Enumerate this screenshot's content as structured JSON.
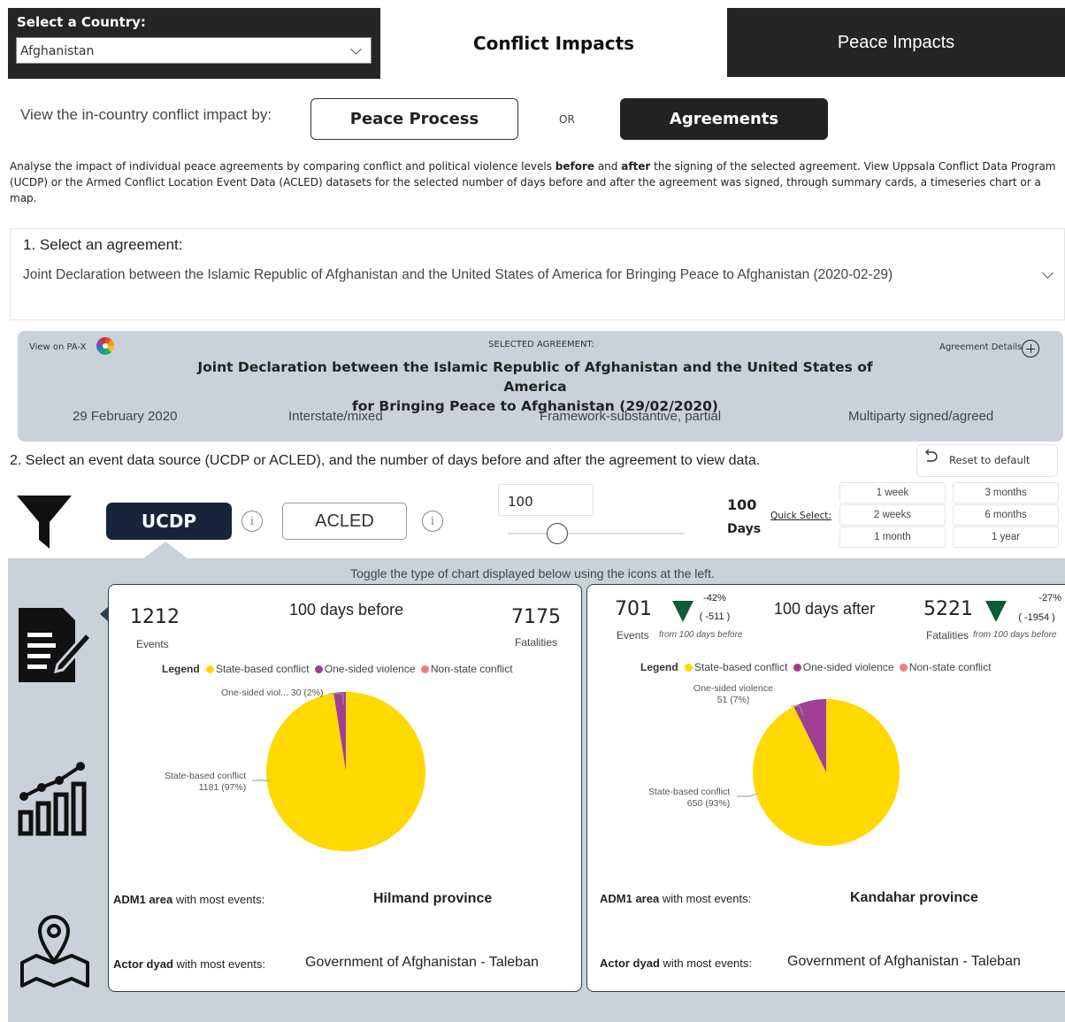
{
  "country": {
    "label": "Select a Country:",
    "value": "Afghanistan"
  },
  "tabs": {
    "conflict": "Conflict Impacts",
    "peace": "Peace Impacts"
  },
  "view_by": {
    "label": "View the in-country conflict impact by:",
    "peace_process": "Peace Process",
    "or": "OR",
    "agreements": "Agreements"
  },
  "intro": {
    "part1": "Analyse the impact of individual peace agreements by comparing conflict and political violence levels ",
    "before": "before",
    "and": " and ",
    "after": "after",
    "part2": " the signing of the selected agreement. View Uppsala Conflict Data Program (UCDP) or the Armed Conflict Location Event Data (ACLED) datasets for the selected number of days before and after the agreement was signed, through summary cards, a timeseries chart or a map."
  },
  "step1": {
    "label": "1. Select an agreement:",
    "value": "Joint Declaration between the Islamic Republic of Afghanistan and the United States of America for Bringing Peace to Afghanistan (2020-02-29)"
  },
  "selected": {
    "pax_link": "View on PA-X",
    "label": "SELECTED AGREEMENT:",
    "details": "Agreement Details",
    "title_line1": "Joint Declaration between the Islamic Republic of Afghanistan and the United States of America",
    "title_line2": "for Bringing Peace to Afghanistan (29/02/2020)",
    "date": "29 February 2020",
    "type": "Interstate/mixed",
    "stage": "Framework-substantive, partial",
    "signing": "Multiparty signed/agreed"
  },
  "step2": {
    "label": "2. Select an event data source (UCDP or ACLED), and the number of days before and after the agreement to view data.",
    "reset": "Reset to default"
  },
  "source": {
    "ucdp": "UCDP",
    "acled": "ACLED",
    "info": "i"
  },
  "days": {
    "input": "100",
    "value": "100",
    "unit": "Days",
    "slider_fraction": 0.28
  },
  "quick_select": {
    "label": "Quick Select:",
    "options": [
      "1 week",
      "3 months",
      "2 weeks",
      "6 months",
      "1 month",
      "1 year"
    ]
  },
  "toggle_note": "Toggle the type of chart displayed below using the icons at the left.",
  "side_icons": [
    "summary-card-icon",
    "timeseries-chart-icon",
    "map-pin-icon"
  ],
  "colors": {
    "state": "#ffd900",
    "onesided": "#a03f96",
    "nonstate": "#f07c88",
    "dark": "#252525",
    "ucdp": "#18243a",
    "panel": "#cbd1d9",
    "down": "#0f5b3a"
  },
  "legend": {
    "title": "Legend",
    "items": [
      "State-based conflict",
      "One-sided violence",
      "Non-state conflict"
    ]
  },
  "before": {
    "title": "100 days before",
    "events": "1212",
    "events_label": "Events",
    "fatalities": "7175",
    "fatalities_label": "Fatalities",
    "pie_onesided_label": "One-sided viol... 30 (2%)",
    "pie_state_label1": "State-based conflict",
    "pie_state_label2": "1181 (97%)",
    "adm1_bold": "ADM1 area",
    "adm1_rest": " with most events:",
    "adm1_value": "Hilmand province",
    "dyad_bold": "Actor dyad",
    "dyad_rest": " with most events:",
    "dyad_value": "Government of Afghanistan - Taleban"
  },
  "after": {
    "title": "100 days after",
    "events": "701",
    "events_label": "Events",
    "events_from": "from 100 days before",
    "events_pct": "-42%",
    "events_diff": "( -511 )",
    "fatalities": "5221",
    "fatalities_label": "Fatalities",
    "fatalities_from": "from 100 days before",
    "fatalities_pct": "-27%",
    "fatalities_diff": "( -1954 )",
    "pie_onesided_label1": "One-sided violence",
    "pie_onesided_label2": "51 (7%)",
    "pie_state_label1": "State-based conflict",
    "pie_state_label2": "650 (93%)",
    "adm1_bold": "ADM1 area",
    "adm1_rest": " with most events:",
    "adm1_value": "Kandahar province",
    "dyad_bold": "Actor dyad",
    "dyad_rest": " with most events:",
    "dyad_value": "Government of Afghanistan - Taleban"
  },
  "chart_data": [
    {
      "type": "pie",
      "categories": [
        "State-based conflict",
        "One-sided violence",
        "Non-state conflict"
      ],
      "values": [
        1181,
        30,
        0
      ],
      "labels": [
        "1181 (97%)",
        "30 (2%)",
        ""
      ]
    },
    {
      "type": "pie",
      "categories": [
        "State-based conflict",
        "One-sided violence",
        "Non-state conflict"
      ],
      "values": [
        650,
        51,
        0
      ],
      "labels": [
        "650 (93%)",
        "51 (7%)",
        ""
      ]
    }
  ]
}
